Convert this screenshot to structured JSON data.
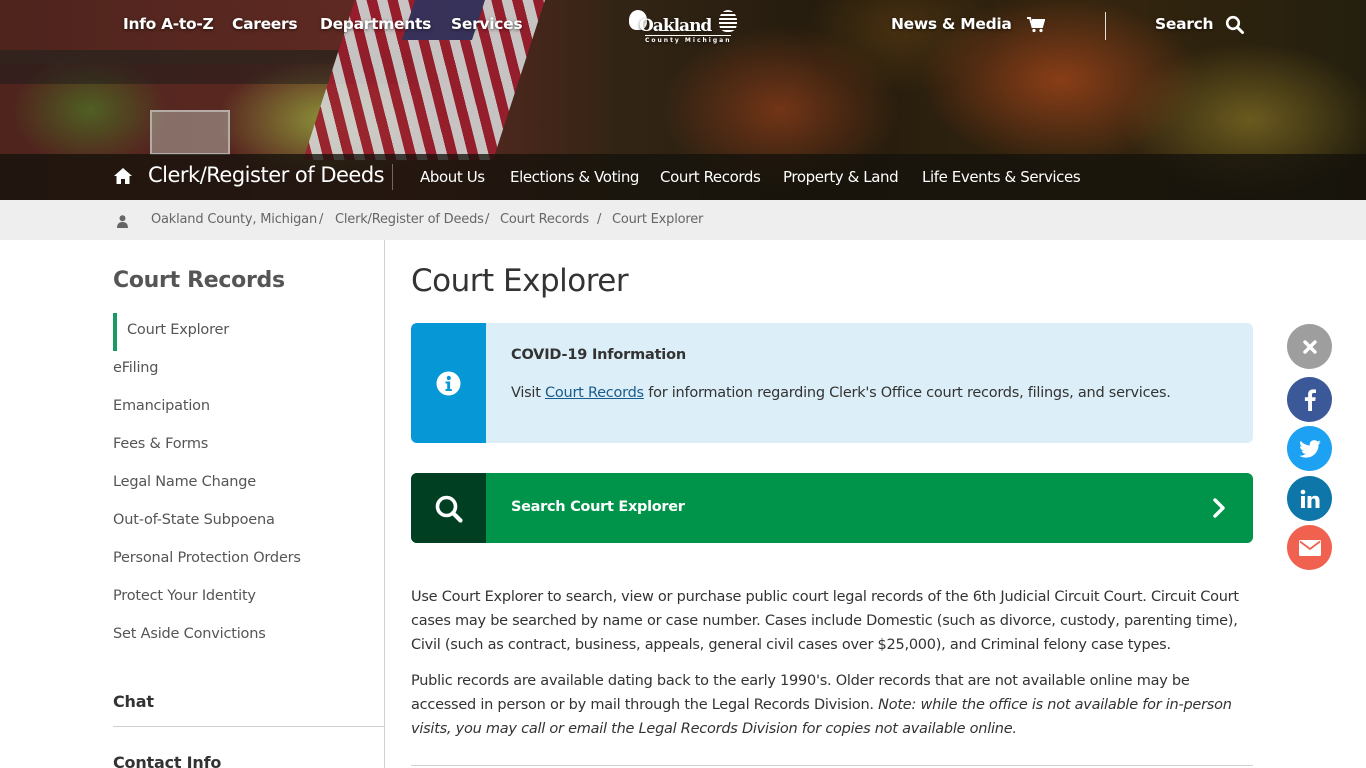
{
  "top_nav": {
    "left_links": [
      "Info A-to-Z",
      "Careers",
      "Departments",
      "Services"
    ],
    "logo": {
      "name": "Oakland",
      "subtitle": "County Michigan"
    },
    "news_label": "News & Media",
    "cart_icon": "shopping-cart-icon",
    "search_label": "Search",
    "search_icon": "search-icon"
  },
  "department_nav": {
    "home_icon": "home-icon",
    "title": "Clerk/Register of Deeds",
    "links": [
      "About Us",
      "Elections & Voting",
      "Court Records",
      "Property & Land",
      "Life Events & Services"
    ]
  },
  "breadcrumb": {
    "icon": "user-icon",
    "items": [
      "Oakland County, Michigan",
      "Clerk/Register of Deeds",
      "Court Records",
      "Court Explorer"
    ],
    "separator": "/"
  },
  "sidebar": {
    "title": "Court Records",
    "active_item": "Court Explorer",
    "items": [
      "Court Explorer",
      "eFiling",
      "Emancipation",
      "Fees & Forms",
      "Legal Name Change",
      "Out-of-State Subpoena",
      "Personal Protection Orders",
      "Protect Your Identity",
      "Set Aside Convictions"
    ],
    "sections": [
      "Chat",
      "Contact Info"
    ]
  },
  "main": {
    "title": "Court Explorer",
    "alert": {
      "icon": "info-circle-icon",
      "title": "COVID-19 Information",
      "text_before": "Visit ",
      "link": "Court Records",
      "text_after": " for information regarding Clerk's Office court records, filings, and services."
    },
    "cta": {
      "icon": "search-icon",
      "label": "Search Court Explorer",
      "chevron": "chevron-right-icon"
    },
    "paragraph1": "Use Court Explorer to search, view or purchase public court legal records of the 6th Judicial Circuit Court. Circuit Court cases may be searched by name or case number. Cases include Domestic (such as divorce, custody, parenting time), Civil (such as contract, business, appeals, general civil cases over $25,000), and Criminal felony case types.",
    "paragraph2": "Public records are available dating back to the early 1990's. Older records that are not available online may be accessed in person or by mail through the Legal Records Division. ",
    "paragraph2_note": "Note: while the office is not available for in-person visits, you may call or email the Legal Records Division for copies not available online."
  },
  "social": [
    {
      "name": "close",
      "icon": "close-icon",
      "color": "#9e9e9e"
    },
    {
      "name": "facebook",
      "icon": "facebook-icon",
      "color": "#3b5998"
    },
    {
      "name": "twitter",
      "icon": "twitter-icon",
      "color": "#1da1f2"
    },
    {
      "name": "linkedin",
      "icon": "linkedin-icon",
      "color": "#0e76a8"
    },
    {
      "name": "email",
      "icon": "email-icon",
      "color": "#f0624f"
    }
  ],
  "colors": {
    "accent_green": "#00944a",
    "dark_green": "#003f22",
    "info_blue": "#0697d6",
    "info_bg": "#dceef7",
    "active_bar": "#1a9a62",
    "link": "#1a5c8a"
  }
}
